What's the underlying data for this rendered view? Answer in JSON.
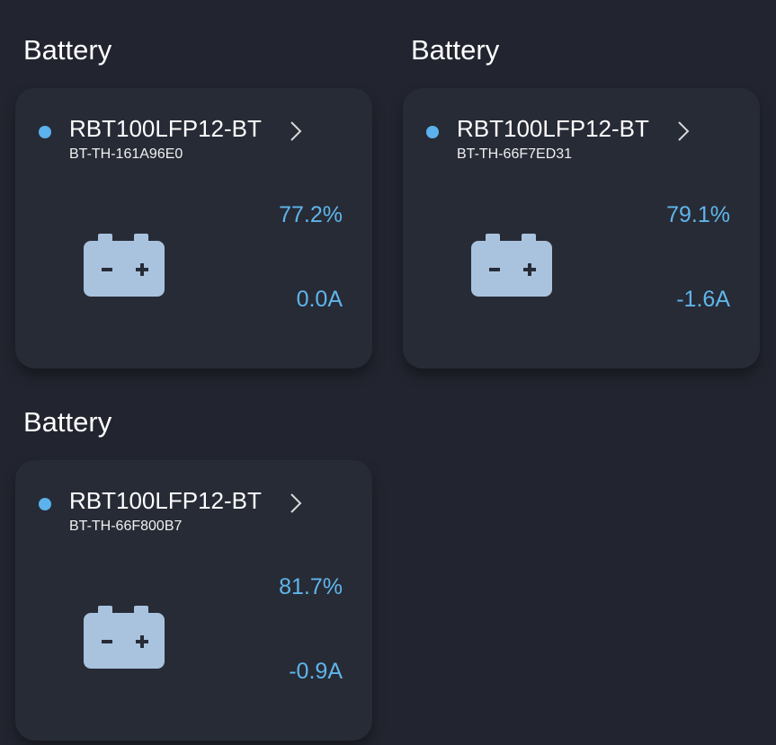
{
  "batteries": [
    {
      "section_title": "Battery",
      "model": "RBT100LFP12-BT",
      "device_id": "BT-TH-161A96E0",
      "soc": "77.2%",
      "current": "0.0A"
    },
    {
      "section_title": "Battery",
      "model": "RBT100LFP12-BT",
      "device_id": "BT-TH-66F7ED31",
      "soc": "79.1%",
      "current": "-1.6A"
    },
    {
      "section_title": "Battery",
      "model": "RBT100LFP12-BT",
      "device_id": "BT-TH-66F800B7",
      "soc": "81.7%",
      "current": "-0.9A"
    }
  ],
  "icons": {
    "status": "status-dot-icon",
    "chevron": "chevron-right-icon",
    "battery": "battery-icon"
  },
  "colors": {
    "background": "#22252f",
    "card": "#272b36",
    "accent": "#5fb5eb",
    "battery_icon": "#a9c3df"
  }
}
